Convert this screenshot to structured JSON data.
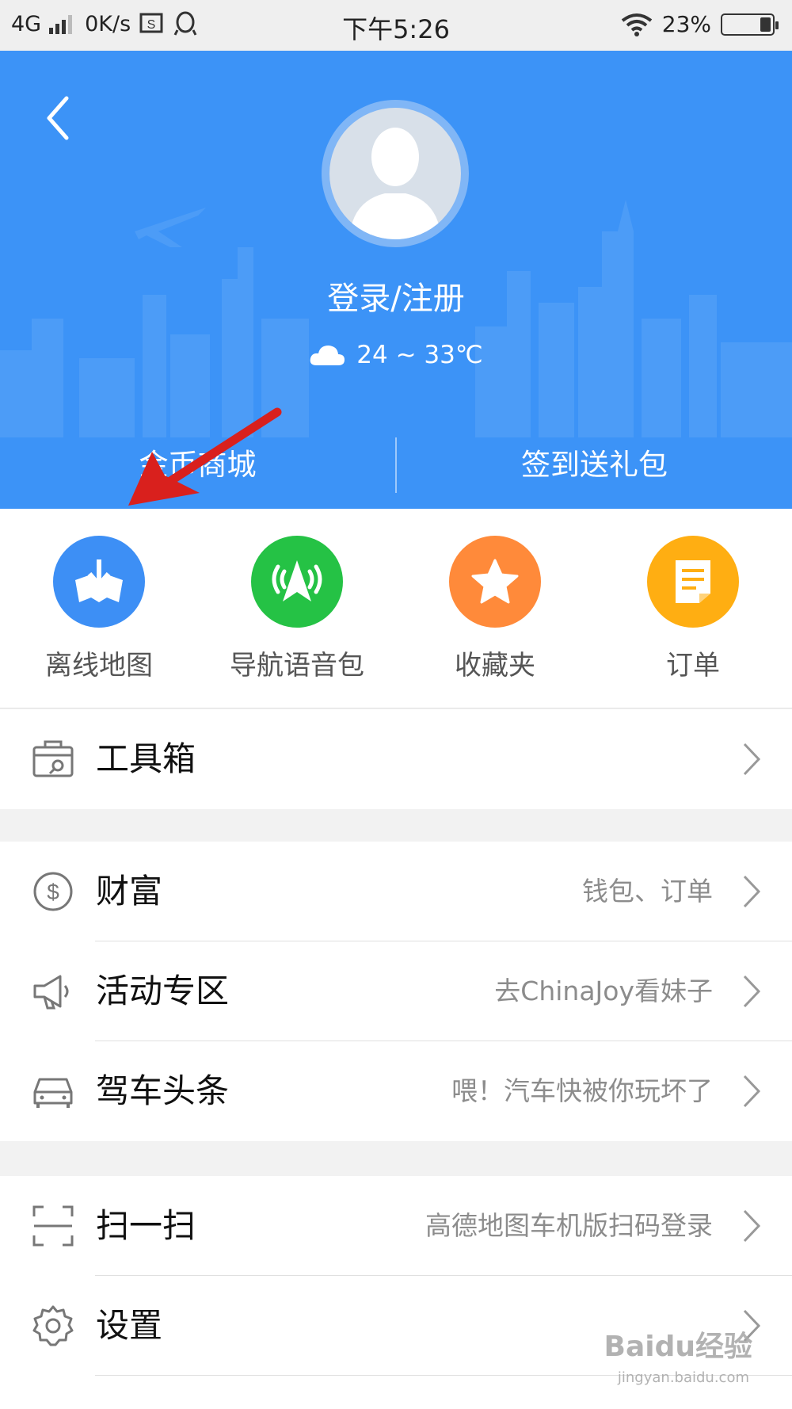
{
  "status_bar": {
    "network": "4G",
    "speed": "0K/s",
    "time": "下午5:26",
    "battery": "23%",
    "battery_level": 0.23
  },
  "header": {
    "login_label": "登录/注册",
    "weather": {
      "icon": "cloud-icon",
      "temperature": "24 ~ 33℃"
    },
    "tabs": [
      "金币商城",
      "签到送礼包"
    ],
    "background_color": "#3c93f7"
  },
  "quick_actions": [
    {
      "label": "离线地图",
      "icon": "offline-map-download-icon",
      "color": "#3d8ff5"
    },
    {
      "label": "导航语音包",
      "icon": "navigation-voice-icon",
      "color": "#25c245"
    },
    {
      "label": "收藏夹",
      "icon": "star-icon",
      "color": "#ff8a3a"
    },
    {
      "label": "订单",
      "icon": "order-document-icon",
      "color": "#ffae12"
    }
  ],
  "menu": {
    "toolbox": {
      "title": "工具箱",
      "icon": "toolbox-icon"
    },
    "wealth": {
      "title": "财富",
      "subtitle": "钱包、订单",
      "icon": "dollar-circle-icon"
    },
    "events": {
      "title": "活动专区",
      "subtitle": "去ChinaJoy看妹子",
      "icon": "megaphone-icon"
    },
    "driving_news": {
      "title": "驾车头条",
      "subtitle": "喂！汽车快被你玩坏了",
      "icon": "car-icon"
    },
    "scan": {
      "title": "扫一扫",
      "subtitle": "高德地图车机版扫码登录",
      "icon": "scan-frame-icon"
    },
    "settings": {
      "title": "设置",
      "icon": "gear-icon"
    }
  },
  "watermark": {
    "logo": "Baidu经验",
    "url": "jingyan.baidu.com"
  }
}
